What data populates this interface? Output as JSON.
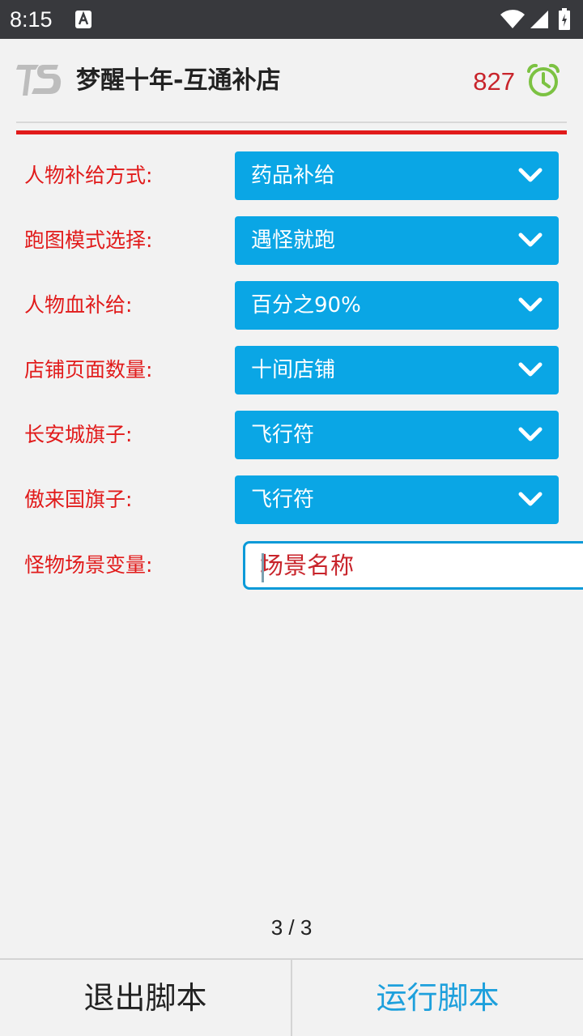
{
  "status_bar": {
    "time": "8:15",
    "icons": [
      "notification-icon",
      "wifi-icon",
      "signal-icon",
      "battery-icon"
    ]
  },
  "header": {
    "title": "梦醒十年-互通补店",
    "timer_count": "827",
    "logo": "TS"
  },
  "form": {
    "rows": [
      {
        "label": "人物补给方式:",
        "value": "药品补给"
      },
      {
        "label": "跑图模式选择:",
        "value": "遇怪就跑"
      },
      {
        "label": "人物血补给:",
        "value": "百分之90%"
      },
      {
        "label": "店铺页面数量:",
        "value": "十间店铺"
      },
      {
        "label": "长安城旗子:",
        "value": "飞行符"
      },
      {
        "label": "傲来国旗子:",
        "value": "飞行符"
      }
    ],
    "input_row": {
      "label": "怪物场景变量:",
      "value": "场景名称"
    }
  },
  "pagination": {
    "text": "3 / 3"
  },
  "bottom": {
    "exit_label": "退出脚本",
    "run_label": "运行脚本"
  },
  "colors": {
    "accent_blue": "#0aa6e5",
    "label_red": "#e11b1b",
    "alarm_green": "#7cc242",
    "status_bar": "#38393d"
  }
}
